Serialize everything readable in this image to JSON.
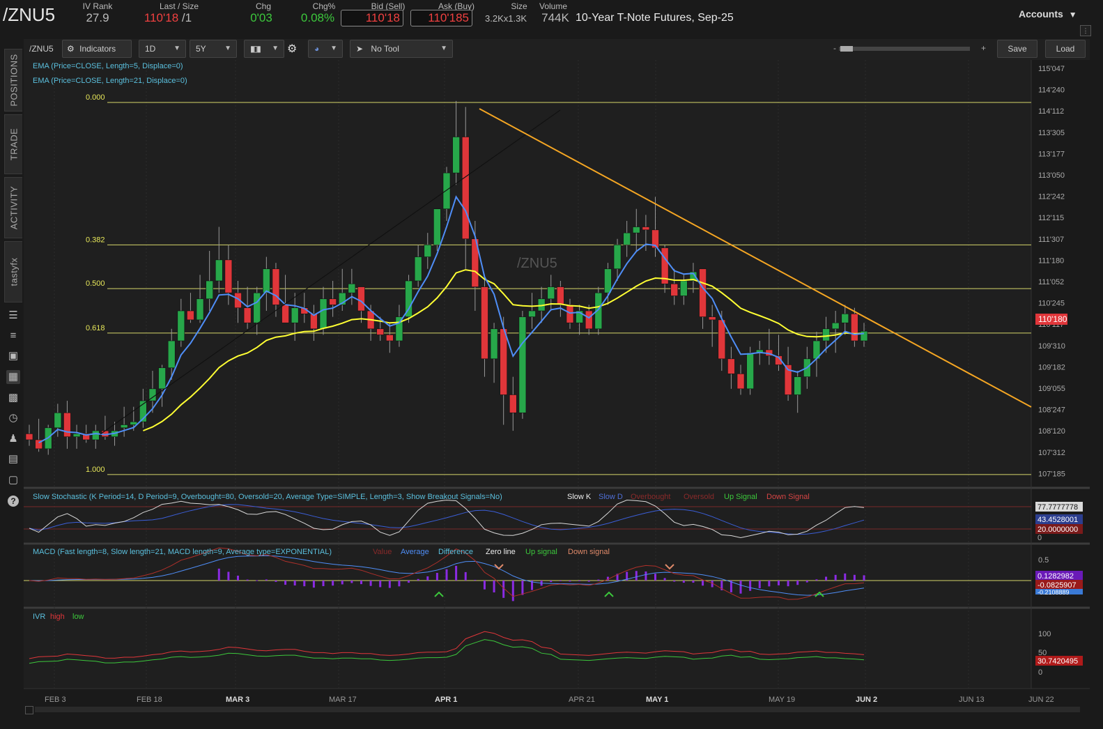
{
  "header": {
    "symbol": "/ZNU5",
    "ivrank_label": "IV Rank",
    "ivrank": "27.9",
    "last_label": "Last / Size",
    "last": "110'18",
    "size": "/1",
    "chg_label": "Chg",
    "chg": "0'03",
    "chgpct_label": "Chg%",
    "chgpct": "0.08%",
    "bid_label": "Bid (Sell)",
    "bid": "110'18",
    "ask_label": "Ask (Buy)",
    "ask": "110'185",
    "sizes_label": "Size",
    "sizes": "3.2Kx1.3K",
    "volume_label": "Volume",
    "volume": "744K",
    "description": "10-Year T-Note Futures, Sep-25",
    "accounts": "Accounts"
  },
  "sidebar": {
    "tabs": [
      "POSITIONS",
      "TRADE",
      "ACTIVITY",
      "tastyfx"
    ],
    "icons": [
      "journal-icon",
      "list-icon",
      "screen-icon",
      "chart-icon",
      "grid-icon",
      "gauge-icon",
      "people-icon",
      "calendar-icon",
      "news-icon",
      "help-icon"
    ]
  },
  "toolbar": {
    "symbol": "/ZNU5",
    "indicators": "Indicators",
    "interval": "1D",
    "range": "5Y",
    "tool": "No Tool",
    "zoom_minus": "-",
    "zoom_plus": "+",
    "save": "Save",
    "load": "Load"
  },
  "chart": {
    "watermark": "/ZNU5",
    "studies": [
      "EMA (Price=CLOSE, Length=5, Displace=0)",
      "EMA (Price=CLOSE, Length=21, Displace=0)"
    ],
    "price_ticks": [
      "115'047",
      "114'240",
      "114'112",
      "113'305",
      "113'177",
      "113'050",
      "112'242",
      "112'115",
      "111'307",
      "111'180",
      "111'052",
      "110'245",
      "110'117",
      "109'310",
      "109'182",
      "109'055",
      "108'247",
      "108'120",
      "107'312",
      "107'185"
    ],
    "last_price_label": "110'180",
    "fib_levels": [
      {
        "label": "0.000",
        "price": 114.375
      },
      {
        "label": "0.382",
        "price": 112.0
      },
      {
        "label": "0.500",
        "price": 111.27
      },
      {
        "label": "0.618",
        "price": 110.53
      },
      {
        "label": "1.000",
        "price": 108.17
      }
    ],
    "date_labels": [
      "FEB 3",
      "FEB 18",
      "MAR 3",
      "MAR 17",
      "APR 1",
      "APR 21",
      "MAY 1",
      "MAY 19",
      "JUN 2",
      "JUN 13",
      "JUN 22"
    ],
    "colors": {
      "up": "#27a74a",
      "down": "#e0363a",
      "ema5": "#4f8ef7",
      "ema21": "#ffff33",
      "trend": "#f5a623",
      "fib": "#d6d66a"
    }
  },
  "stochastic": {
    "title": "Slow Stochastic (K Period=14, D Period=9, Overbought=80, Oversold=20, Average Type=SIMPLE, Length=3, Show Breakout Signals=No)",
    "legend": [
      "Slow K",
      "Slow D",
      "Overbought",
      "Oversold",
      "Up Signal",
      "Down Signal"
    ],
    "labels": {
      "k": "77.7777778",
      "d": "43.4528001",
      "oversold": "20.0000000",
      "zero": "0"
    }
  },
  "macd": {
    "title": "MACD (Fast length=8, Slow length=21, MACD length=9, Average type=EXPONENTIAL)",
    "legend": [
      "Value",
      "Average",
      "Difference",
      "Zero line",
      "Up signal",
      "Down signal"
    ],
    "labels": {
      "top": "0.5",
      "value": "0.1282982",
      "avg": "-0.0825907",
      "diff": "-0.2108889"
    }
  },
  "ivr": {
    "title": "IVR",
    "legend": [
      "high",
      "low"
    ],
    "labels": {
      "hundred": "100",
      "fifty": "50",
      "value": "30.7420495",
      "zero": "0"
    }
  },
  "chart_data": {
    "type": "candlestick",
    "symbol": "/ZNU5",
    "y_unit": "price (points'32nds)",
    "ylim": [
      107.5,
      115.3
    ],
    "x_labels": [
      "FEB 3",
      "FEB 18",
      "MAR 3",
      "MAR 17",
      "APR 1",
      "APR 21",
      "MAY 1",
      "MAY 19",
      "JUN 2",
      "JUN 13",
      "JUN 22"
    ],
    "candles": [
      [
        108.85,
        109.0,
        108.65,
        108.75
      ],
      [
        108.75,
        109.1,
        108.55,
        108.6
      ],
      [
        108.6,
        109.0,
        108.5,
        108.95
      ],
      [
        108.95,
        109.35,
        108.8,
        109.2
      ],
      [
        109.2,
        109.4,
        108.6,
        108.8
      ],
      [
        108.8,
        109.0,
        108.6,
        108.85
      ],
      [
        108.85,
        109.0,
        108.7,
        108.75
      ],
      [
        108.75,
        109.0,
        108.6,
        108.9
      ],
      [
        108.9,
        109.15,
        108.75,
        108.8
      ],
      [
        108.8,
        109.05,
        108.65,
        108.9
      ],
      [
        108.95,
        109.3,
        108.8,
        109.0
      ],
      [
        109.0,
        109.3,
        108.9,
        109.05
      ],
      [
        109.05,
        109.6,
        108.95,
        109.4
      ],
      [
        109.4,
        109.9,
        109.2,
        109.6
      ],
      [
        109.6,
        110.0,
        109.3,
        109.95
      ],
      [
        109.95,
        110.6,
        109.75,
        110.4
      ],
      [
        110.4,
        111.1,
        110.3,
        110.9
      ],
      [
        110.9,
        111.2,
        110.7,
        110.75
      ],
      [
        110.75,
        111.5,
        110.7,
        111.1
      ],
      [
        111.1,
        111.9,
        110.9,
        111.4
      ],
      [
        111.4,
        112.3,
        111.2,
        111.75
      ],
      [
        111.75,
        112.0,
        111.0,
        111.2
      ],
      [
        111.2,
        111.4,
        110.7,
        110.95
      ],
      [
        110.95,
        111.3,
        110.6,
        110.7
      ],
      [
        110.7,
        111.3,
        110.5,
        111.2
      ],
      [
        111.2,
        111.8,
        110.9,
        111.6
      ],
      [
        111.6,
        111.7,
        110.8,
        111.0
      ],
      [
        111.0,
        111.5,
        110.7,
        110.7
      ],
      [
        110.7,
        111.2,
        110.4,
        110.95
      ],
      [
        110.95,
        111.2,
        110.7,
        110.85
      ],
      [
        110.85,
        111.0,
        110.4,
        110.6
      ],
      [
        110.6,
        111.3,
        110.5,
        111.1
      ],
      [
        111.1,
        111.4,
        110.8,
        111.0
      ],
      [
        111.0,
        111.6,
        110.9,
        111.2
      ],
      [
        111.2,
        111.6,
        111.0,
        111.35
      ],
      [
        111.3,
        111.3,
        110.7,
        110.9
      ],
      [
        110.9,
        111.0,
        110.4,
        110.6
      ],
      [
        110.6,
        110.8,
        110.4,
        110.5
      ],
      [
        110.5,
        110.7,
        110.2,
        110.4
      ],
      [
        110.4,
        111.0,
        110.3,
        110.8
      ],
      [
        110.8,
        111.5,
        110.7,
        111.4
      ],
      [
        111.4,
        112.0,
        111.3,
        111.8
      ],
      [
        111.8,
        112.2,
        111.6,
        112.0
      ],
      [
        112.0,
        112.6,
        111.9,
        112.6
      ],
      [
        112.6,
        113.3,
        112.4,
        113.2
      ],
      [
        113.2,
        114.4,
        113.0,
        113.8
      ],
      [
        113.8,
        114.3,
        111.6,
        112.1
      ],
      [
        112.1,
        112.4,
        110.9,
        111.3
      ],
      [
        111.3,
        111.5,
        109.8,
        110.1
      ],
      [
        110.1,
        110.7,
        109.7,
        110.6
      ],
      [
        110.6,
        110.8,
        109.0,
        109.5
      ],
      [
        109.5,
        109.8,
        108.9,
        109.2
      ],
      [
        109.2,
        110.9,
        109.1,
        110.8
      ],
      [
        110.8,
        111.2,
        110.6,
        110.9
      ],
      [
        110.9,
        111.3,
        110.7,
        111.1
      ],
      [
        111.1,
        111.5,
        110.9,
        111.3
      ],
      [
        111.3,
        111.4,
        110.8,
        111.0
      ],
      [
        111.0,
        111.1,
        110.6,
        110.7
      ],
      [
        110.7,
        111.0,
        110.5,
        110.9
      ],
      [
        110.9,
        111.0,
        110.5,
        110.6
      ],
      [
        110.6,
        111.3,
        110.5,
        111.2
      ],
      [
        111.2,
        111.7,
        111.0,
        111.6
      ],
      [
        111.6,
        112.1,
        111.4,
        112.0
      ],
      [
        112.0,
        112.4,
        111.8,
        112.2
      ],
      [
        112.2,
        112.6,
        111.9,
        112.3
      ],
      [
        112.3,
        112.5,
        111.9,
        112.25
      ],
      [
        112.25,
        112.8,
        111.8,
        111.95
      ],
      [
        111.95,
        112.0,
        111.2,
        111.35
      ],
      [
        111.35,
        111.6,
        111.0,
        111.15
      ],
      [
        111.15,
        111.5,
        111.0,
        111.4
      ],
      [
        111.4,
        111.7,
        111.2,
        111.55
      ],
      [
        111.6,
        111.6,
        110.6,
        110.8
      ],
      [
        110.8,
        111.0,
        110.3,
        110.75
      ],
      [
        110.75,
        110.9,
        109.9,
        110.1
      ],
      [
        110.1,
        110.3,
        109.6,
        109.85
      ],
      [
        109.85,
        110.0,
        109.5,
        109.6
      ],
      [
        109.6,
        110.3,
        109.5,
        110.2
      ],
      [
        110.2,
        110.4,
        110.0,
        110.25
      ],
      [
        110.25,
        110.6,
        110.0,
        110.15
      ],
      [
        110.15,
        110.5,
        109.9,
        110.0
      ],
      [
        110.0,
        110.3,
        109.4,
        109.5
      ],
      [
        109.5,
        109.9,
        109.2,
        109.8
      ],
      [
        109.8,
        110.3,
        109.6,
        110.1
      ],
      [
        110.1,
        110.55,
        109.8,
        110.4
      ],
      [
        110.4,
        110.8,
        110.2,
        110.6
      ],
      [
        110.6,
        110.9,
        110.2,
        110.7
      ],
      [
        110.7,
        111.0,
        110.5,
        110.85
      ],
      [
        110.85,
        110.95,
        110.3,
        110.4
      ],
      [
        110.4,
        110.7,
        110.3,
        110.56
      ]
    ]
  }
}
